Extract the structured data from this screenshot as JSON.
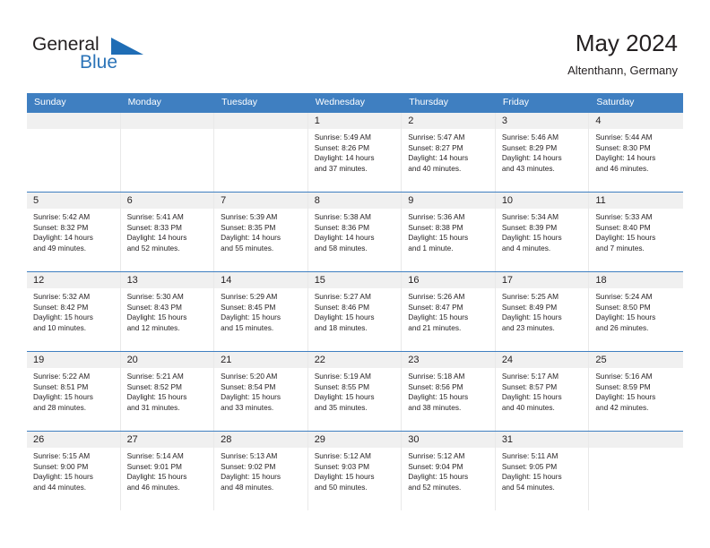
{
  "brand": {
    "name_part1": "General",
    "name_part2": "Blue",
    "flag_icon": "blue-flag-icon"
  },
  "header": {
    "title": "May 2024",
    "subtitle": "Altenthann, Germany"
  },
  "colors": {
    "header_blue": "#3f7fc1",
    "brand_blue": "#2c74b8",
    "day_band": "#f0f0f0",
    "text": "#231f20"
  },
  "weekdays": [
    "Sunday",
    "Monday",
    "Tuesday",
    "Wednesday",
    "Thursday",
    "Friday",
    "Saturday"
  ],
  "weeks": [
    [
      {
        "day": "",
        "sunrise": "",
        "sunset": "",
        "daylight1": "",
        "daylight2": ""
      },
      {
        "day": "",
        "sunrise": "",
        "sunset": "",
        "daylight1": "",
        "daylight2": ""
      },
      {
        "day": "",
        "sunrise": "",
        "sunset": "",
        "daylight1": "",
        "daylight2": ""
      },
      {
        "day": "1",
        "sunrise": "Sunrise: 5:49 AM",
        "sunset": "Sunset: 8:26 PM",
        "daylight1": "Daylight: 14 hours",
        "daylight2": "and 37 minutes."
      },
      {
        "day": "2",
        "sunrise": "Sunrise: 5:47 AM",
        "sunset": "Sunset: 8:27 PM",
        "daylight1": "Daylight: 14 hours",
        "daylight2": "and 40 minutes."
      },
      {
        "day": "3",
        "sunrise": "Sunrise: 5:46 AM",
        "sunset": "Sunset: 8:29 PM",
        "daylight1": "Daylight: 14 hours",
        "daylight2": "and 43 minutes."
      },
      {
        "day": "4",
        "sunrise": "Sunrise: 5:44 AM",
        "sunset": "Sunset: 8:30 PM",
        "daylight1": "Daylight: 14 hours",
        "daylight2": "and 46 minutes."
      }
    ],
    [
      {
        "day": "5",
        "sunrise": "Sunrise: 5:42 AM",
        "sunset": "Sunset: 8:32 PM",
        "daylight1": "Daylight: 14 hours",
        "daylight2": "and 49 minutes."
      },
      {
        "day": "6",
        "sunrise": "Sunrise: 5:41 AM",
        "sunset": "Sunset: 8:33 PM",
        "daylight1": "Daylight: 14 hours",
        "daylight2": "and 52 minutes."
      },
      {
        "day": "7",
        "sunrise": "Sunrise: 5:39 AM",
        "sunset": "Sunset: 8:35 PM",
        "daylight1": "Daylight: 14 hours",
        "daylight2": "and 55 minutes."
      },
      {
        "day": "8",
        "sunrise": "Sunrise: 5:38 AM",
        "sunset": "Sunset: 8:36 PM",
        "daylight1": "Daylight: 14 hours",
        "daylight2": "and 58 minutes."
      },
      {
        "day": "9",
        "sunrise": "Sunrise: 5:36 AM",
        "sunset": "Sunset: 8:38 PM",
        "daylight1": "Daylight: 15 hours",
        "daylight2": "and 1 minute."
      },
      {
        "day": "10",
        "sunrise": "Sunrise: 5:34 AM",
        "sunset": "Sunset: 8:39 PM",
        "daylight1": "Daylight: 15 hours",
        "daylight2": "and 4 minutes."
      },
      {
        "day": "11",
        "sunrise": "Sunrise: 5:33 AM",
        "sunset": "Sunset: 8:40 PM",
        "daylight1": "Daylight: 15 hours",
        "daylight2": "and 7 minutes."
      }
    ],
    [
      {
        "day": "12",
        "sunrise": "Sunrise: 5:32 AM",
        "sunset": "Sunset: 8:42 PM",
        "daylight1": "Daylight: 15 hours",
        "daylight2": "and 10 minutes."
      },
      {
        "day": "13",
        "sunrise": "Sunrise: 5:30 AM",
        "sunset": "Sunset: 8:43 PM",
        "daylight1": "Daylight: 15 hours",
        "daylight2": "and 12 minutes."
      },
      {
        "day": "14",
        "sunrise": "Sunrise: 5:29 AM",
        "sunset": "Sunset: 8:45 PM",
        "daylight1": "Daylight: 15 hours",
        "daylight2": "and 15 minutes."
      },
      {
        "day": "15",
        "sunrise": "Sunrise: 5:27 AM",
        "sunset": "Sunset: 8:46 PM",
        "daylight1": "Daylight: 15 hours",
        "daylight2": "and 18 minutes."
      },
      {
        "day": "16",
        "sunrise": "Sunrise: 5:26 AM",
        "sunset": "Sunset: 8:47 PM",
        "daylight1": "Daylight: 15 hours",
        "daylight2": "and 21 minutes."
      },
      {
        "day": "17",
        "sunrise": "Sunrise: 5:25 AM",
        "sunset": "Sunset: 8:49 PM",
        "daylight1": "Daylight: 15 hours",
        "daylight2": "and 23 minutes."
      },
      {
        "day": "18",
        "sunrise": "Sunrise: 5:24 AM",
        "sunset": "Sunset: 8:50 PM",
        "daylight1": "Daylight: 15 hours",
        "daylight2": "and 26 minutes."
      }
    ],
    [
      {
        "day": "19",
        "sunrise": "Sunrise: 5:22 AM",
        "sunset": "Sunset: 8:51 PM",
        "daylight1": "Daylight: 15 hours",
        "daylight2": "and 28 minutes."
      },
      {
        "day": "20",
        "sunrise": "Sunrise: 5:21 AM",
        "sunset": "Sunset: 8:52 PM",
        "daylight1": "Daylight: 15 hours",
        "daylight2": "and 31 minutes."
      },
      {
        "day": "21",
        "sunrise": "Sunrise: 5:20 AM",
        "sunset": "Sunset: 8:54 PM",
        "daylight1": "Daylight: 15 hours",
        "daylight2": "and 33 minutes."
      },
      {
        "day": "22",
        "sunrise": "Sunrise: 5:19 AM",
        "sunset": "Sunset: 8:55 PM",
        "daylight1": "Daylight: 15 hours",
        "daylight2": "and 35 minutes."
      },
      {
        "day": "23",
        "sunrise": "Sunrise: 5:18 AM",
        "sunset": "Sunset: 8:56 PM",
        "daylight1": "Daylight: 15 hours",
        "daylight2": "and 38 minutes."
      },
      {
        "day": "24",
        "sunrise": "Sunrise: 5:17 AM",
        "sunset": "Sunset: 8:57 PM",
        "daylight1": "Daylight: 15 hours",
        "daylight2": "and 40 minutes."
      },
      {
        "day": "25",
        "sunrise": "Sunrise: 5:16 AM",
        "sunset": "Sunset: 8:59 PM",
        "daylight1": "Daylight: 15 hours",
        "daylight2": "and 42 minutes."
      }
    ],
    [
      {
        "day": "26",
        "sunrise": "Sunrise: 5:15 AM",
        "sunset": "Sunset: 9:00 PM",
        "daylight1": "Daylight: 15 hours",
        "daylight2": "and 44 minutes."
      },
      {
        "day": "27",
        "sunrise": "Sunrise: 5:14 AM",
        "sunset": "Sunset: 9:01 PM",
        "daylight1": "Daylight: 15 hours",
        "daylight2": "and 46 minutes."
      },
      {
        "day": "28",
        "sunrise": "Sunrise: 5:13 AM",
        "sunset": "Sunset: 9:02 PM",
        "daylight1": "Daylight: 15 hours",
        "daylight2": "and 48 minutes."
      },
      {
        "day": "29",
        "sunrise": "Sunrise: 5:12 AM",
        "sunset": "Sunset: 9:03 PM",
        "daylight1": "Daylight: 15 hours",
        "daylight2": "and 50 minutes."
      },
      {
        "day": "30",
        "sunrise": "Sunrise: 5:12 AM",
        "sunset": "Sunset: 9:04 PM",
        "daylight1": "Daylight: 15 hours",
        "daylight2": "and 52 minutes."
      },
      {
        "day": "31",
        "sunrise": "Sunrise: 5:11 AM",
        "sunset": "Sunset: 9:05 PM",
        "daylight1": "Daylight: 15 hours",
        "daylight2": "and 54 minutes."
      },
      {
        "day": "",
        "sunrise": "",
        "sunset": "",
        "daylight1": "",
        "daylight2": ""
      }
    ]
  ]
}
